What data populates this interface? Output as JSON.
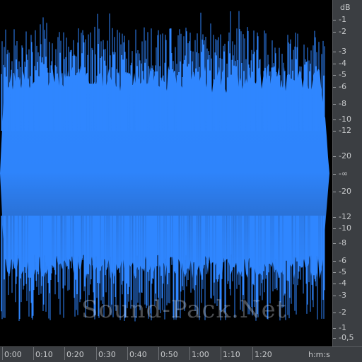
{
  "db_scale": {
    "unit": "dB",
    "upper": [
      "-1",
      "-2",
      "-3",
      "-4",
      "-5",
      "-6",
      "-8",
      "-10",
      "-12",
      "-20"
    ],
    "center": "-∞",
    "lower": [
      "-20",
      "-12",
      "-10",
      "-8",
      "-6",
      "-5",
      "-4",
      "-3",
      "-2",
      "-1",
      "-0,5"
    ]
  },
  "time_scale": {
    "labels": [
      "0:00",
      "0:10",
      "0:20",
      "0:30",
      "0:40",
      "0:50",
      "1:00",
      "1:10",
      "1:20"
    ],
    "unit": "h:m:s"
  },
  "watermark": "Sound-Pack.Net",
  "colors": {
    "waveform": "#2f86ff",
    "waveform_dark": "#2a74dd",
    "background": "#000000",
    "ruler_bg": "#3b3e42",
    "ruler_text": "#c8cacc"
  }
}
